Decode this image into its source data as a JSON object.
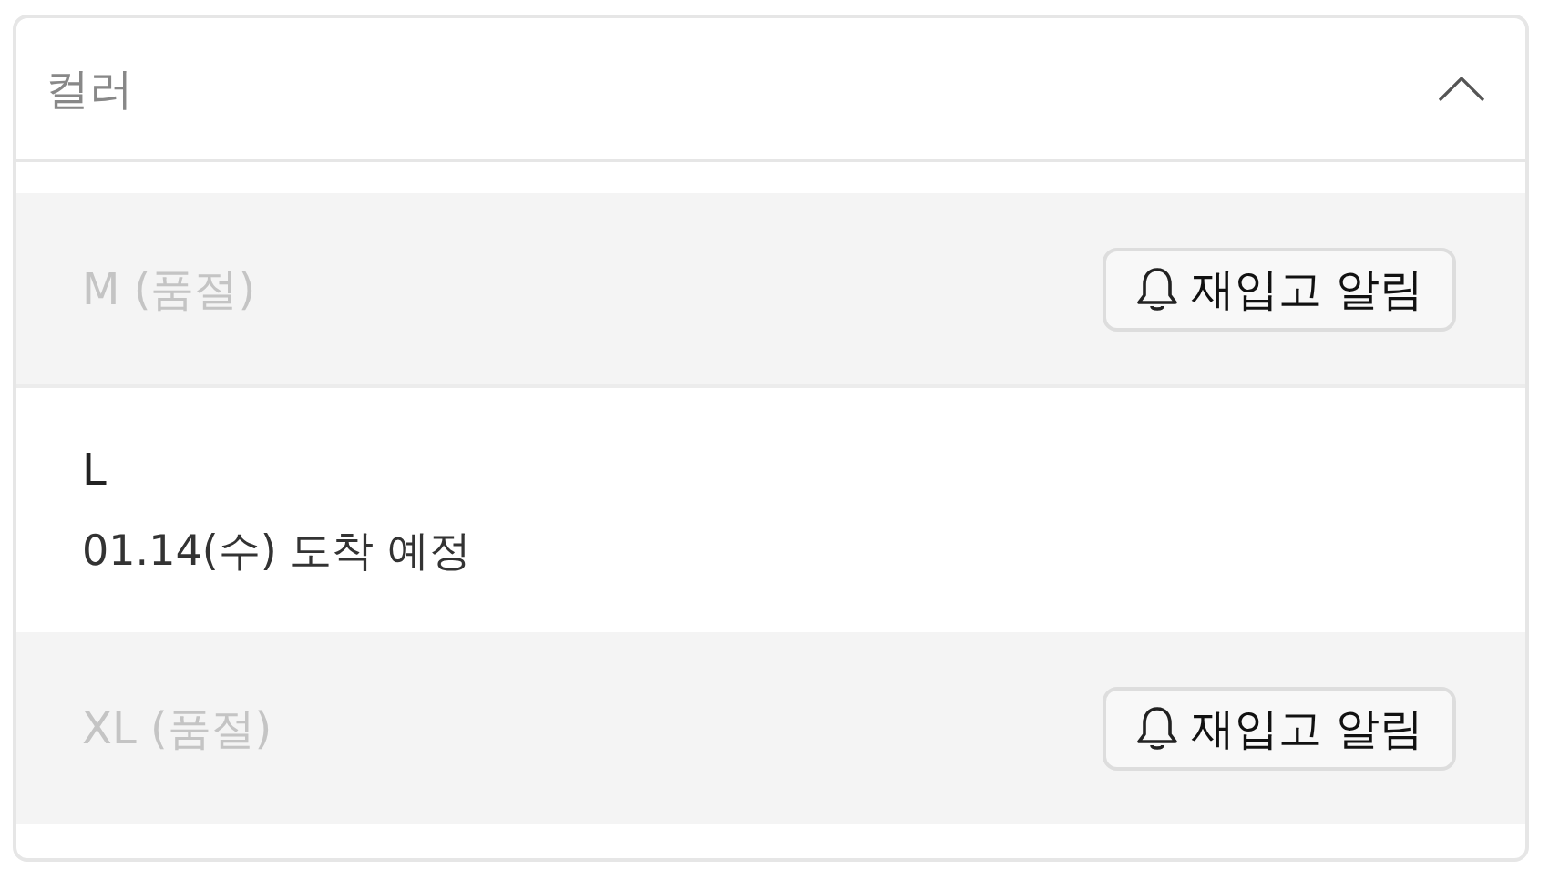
{
  "dropdown": {
    "label": "컬러",
    "expanded": true
  },
  "options": [
    {
      "label": "M (품절)",
      "sold_out": true,
      "button": "재입고 알림"
    },
    {
      "label": "L",
      "sold_out": false,
      "note": "01.14(수) 도착 예정"
    },
    {
      "label": "XL (품절)",
      "sold_out": true,
      "button": "재입고 알림"
    }
  ]
}
